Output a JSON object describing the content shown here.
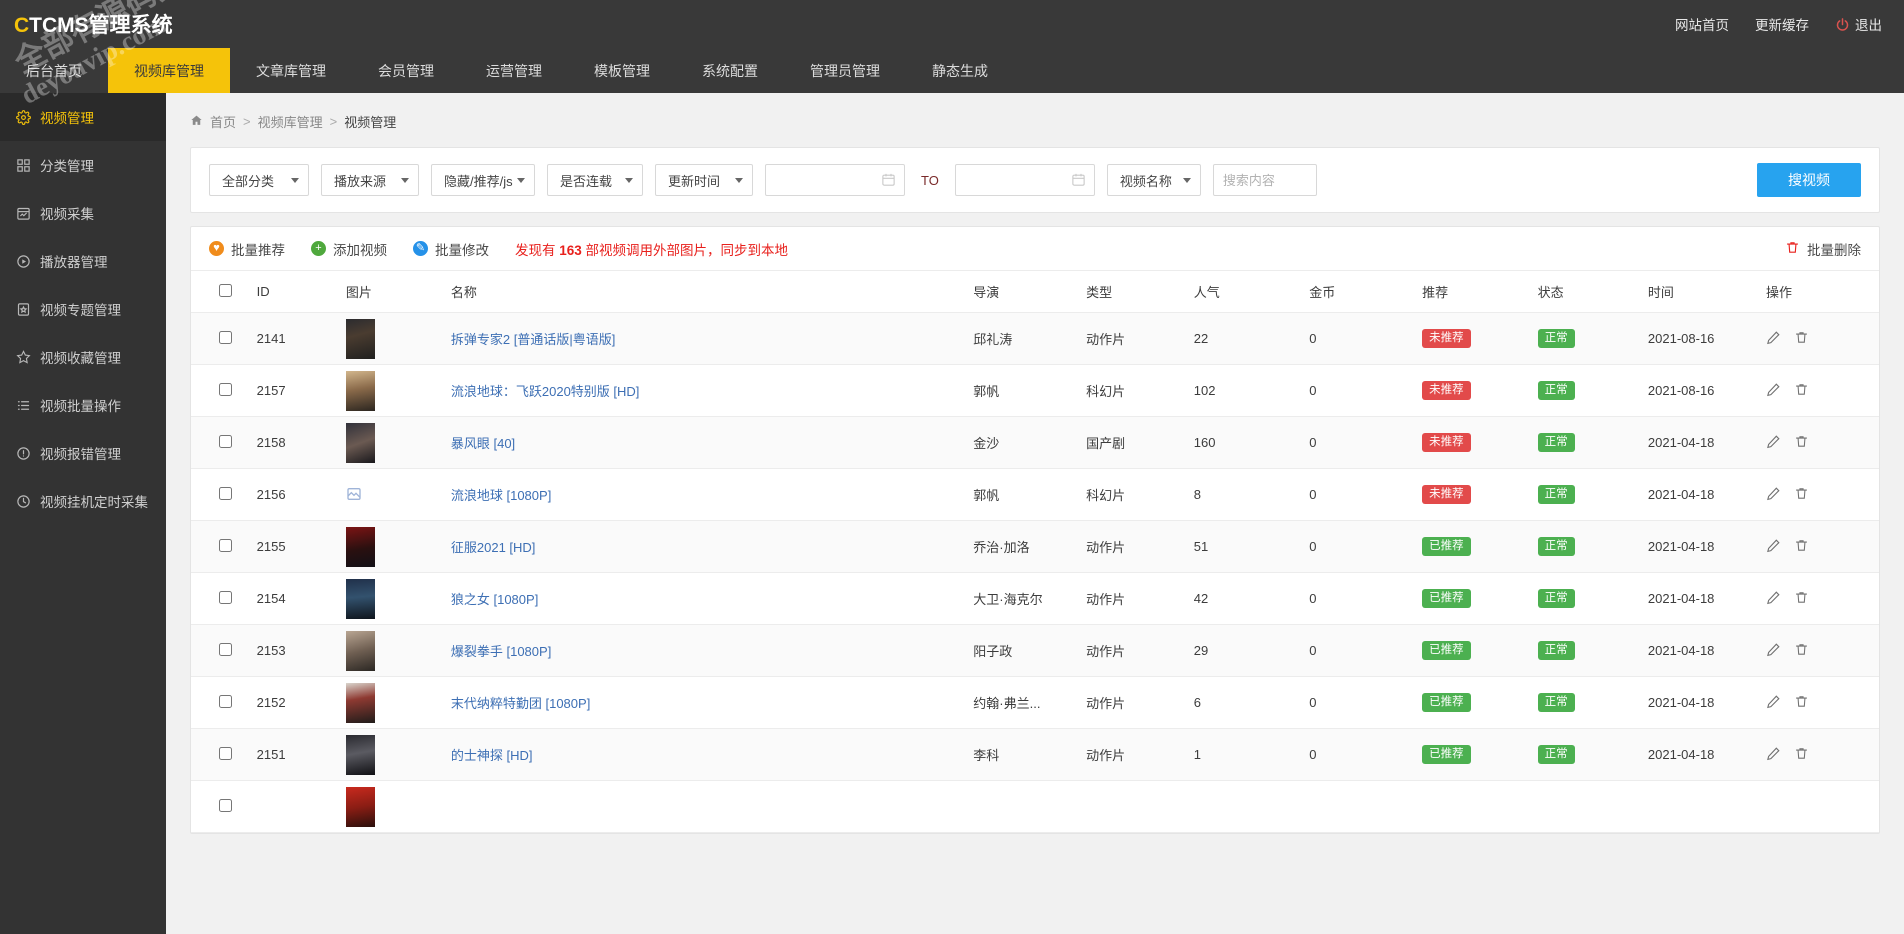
{
  "app": {
    "brand_prefix": "C",
    "brand_rest": "TCMS管理系统",
    "brand_full": "CTCMS管理系统"
  },
  "watermark": {
    "line1": "全部有源码资源网",
    "line2": "deyouvip.com"
  },
  "topbar": {
    "items": [
      {
        "label": "网站首页",
        "icon": ""
      },
      {
        "label": "更新缓存",
        "icon": ""
      },
      {
        "label": "退出",
        "icon": "power-icon"
      }
    ]
  },
  "navtabs": [
    {
      "label": "后台首页",
      "active": false
    },
    {
      "label": "视频库管理",
      "active": true
    },
    {
      "label": "文章库管理",
      "active": false
    },
    {
      "label": "会员管理",
      "active": false
    },
    {
      "label": "运营管理",
      "active": false
    },
    {
      "label": "模板管理",
      "active": false
    },
    {
      "label": "系统配置",
      "active": false
    },
    {
      "label": "管理员管理",
      "active": false
    },
    {
      "label": "静态生成",
      "active": false
    }
  ],
  "sidebar": {
    "items": [
      {
        "label": "视频管理",
        "icon": "gear-icon",
        "active": true
      },
      {
        "label": "分类管理",
        "icon": "grid-icon",
        "active": false
      },
      {
        "label": "视频采集",
        "icon": "chart-box-icon",
        "active": false
      },
      {
        "label": "播放器管理",
        "icon": "play-circle-icon",
        "active": false
      },
      {
        "label": "视频专题管理",
        "icon": "file-star-icon",
        "active": false
      },
      {
        "label": "视频收藏管理",
        "icon": "star-icon",
        "active": false
      },
      {
        "label": "视频批量操作",
        "icon": "list-icon",
        "active": false
      },
      {
        "label": "视频报错管理",
        "icon": "alert-circle-icon",
        "active": false
      },
      {
        "label": "视频挂机定时采集",
        "icon": "clock-icon",
        "active": false
      }
    ]
  },
  "breadcrumb": {
    "home_icon": "home-icon",
    "items": [
      "首页",
      "视频库管理",
      "视频管理"
    ],
    "separator": ">"
  },
  "filters": {
    "category": "全部分类",
    "source": "播放来源",
    "hidden_rec": "隐藏/推荐/js",
    "serial": "是否连载",
    "update_time": "更新时间",
    "date_from": "",
    "date_to": "",
    "date_placeholder": "",
    "to_label": "TO",
    "search_field": "视频名称",
    "search_value": "",
    "search_placeholder": "搜索内容",
    "search_button": "搜视频"
  },
  "actions": {
    "batch_recommend": "批量推荐",
    "add_video": "添加视频",
    "batch_edit": "批量修改",
    "notice_prefix": "发现有 ",
    "notice_count": "163",
    "notice_suffix": " 部视频调用外部图片，同步到本地",
    "notice_full": "发现有 163 部视频调用外部图片，同步到本地",
    "batch_delete": "批量删除"
  },
  "table": {
    "headers": [
      "",
      "ID",
      "图片",
      "名称",
      "导演",
      "类型",
      "人气",
      "金币",
      "推荐",
      "状态",
      "时间",
      "操作"
    ],
    "rows": [
      {
        "id": "2141",
        "thumb": "th1",
        "broken": false,
        "name": "拆弹专家2 [普通话版|粤语版]",
        "director": "邱礼涛",
        "type": "动作片",
        "popularity": "22",
        "coins": "0",
        "recommend": "未推荐",
        "recommend_state": "red",
        "status": "正常",
        "time": "2021-08-16"
      },
      {
        "id": "2157",
        "thumb": "th2",
        "broken": false,
        "name": "流浪地球：飞跃2020特别版 [HD]",
        "director": "郭帆",
        "type": "科幻片",
        "popularity": "102",
        "coins": "0",
        "recommend": "未推荐",
        "recommend_state": "red",
        "status": "正常",
        "time": "2021-08-16"
      },
      {
        "id": "2158",
        "thumb": "th3",
        "broken": false,
        "name": "暴风眼 [40]",
        "director": "金沙",
        "type": "国产剧",
        "popularity": "160",
        "coins": "0",
        "recommend": "未推荐",
        "recommend_state": "red",
        "status": "正常",
        "time": "2021-04-18"
      },
      {
        "id": "2156",
        "thumb": "",
        "broken": true,
        "name": "流浪地球 [1080P]",
        "director": "郭帆",
        "type": "科幻片",
        "popularity": "8",
        "coins": "0",
        "recommend": "未推荐",
        "recommend_state": "red",
        "status": "正常",
        "time": "2021-04-18"
      },
      {
        "id": "2155",
        "thumb": "th4",
        "broken": false,
        "name": "征服2021 [HD]",
        "director": "乔治·加洛",
        "type": "动作片",
        "popularity": "51",
        "coins": "0",
        "recommend": "已推荐",
        "recommend_state": "green",
        "status": "正常",
        "time": "2021-04-18"
      },
      {
        "id": "2154",
        "thumb": "th5",
        "broken": false,
        "name": "狼之女 [1080P]",
        "director": "大卫·海克尔",
        "type": "动作片",
        "popularity": "42",
        "coins": "0",
        "recommend": "已推荐",
        "recommend_state": "green",
        "status": "正常",
        "time": "2021-04-18"
      },
      {
        "id": "2153",
        "thumb": "th6",
        "broken": false,
        "name": "爆裂拳手 [1080P]",
        "director": "阳子政",
        "type": "动作片",
        "popularity": "29",
        "coins": "0",
        "recommend": "已推荐",
        "recommend_state": "green",
        "status": "正常",
        "time": "2021-04-18"
      },
      {
        "id": "2152",
        "thumb": "th7",
        "broken": false,
        "name": "末代纳粹特勤团 [1080P]",
        "director": "约翰·弗兰...",
        "type": "动作片",
        "popularity": "6",
        "coins": "0",
        "recommend": "已推荐",
        "recommend_state": "green",
        "status": "正常",
        "time": "2021-04-18"
      },
      {
        "id": "2151",
        "thumb": "th8",
        "broken": false,
        "name": "的士神探 [HD]",
        "director": "李科",
        "type": "动作片",
        "popularity": "1",
        "coins": "0",
        "recommend": "已推荐",
        "recommend_state": "green",
        "status": "正常",
        "time": "2021-04-18"
      },
      {
        "id": "",
        "thumb": "th9",
        "broken": false,
        "name": "",
        "director": "",
        "type": "",
        "popularity": "",
        "coins": "",
        "recommend": "",
        "recommend_state": "",
        "status": "",
        "time": ""
      }
    ]
  },
  "colors": {
    "brand_yellow": "#f5c30a",
    "nav_dark": "#393939",
    "sidebar_dark": "#333333",
    "accent_blue": "#27a3ef",
    "badge_red": "#e24a4a",
    "badge_green": "#4cb050",
    "notice_red": "#e8201c",
    "link_blue": "#3d6fb4"
  }
}
